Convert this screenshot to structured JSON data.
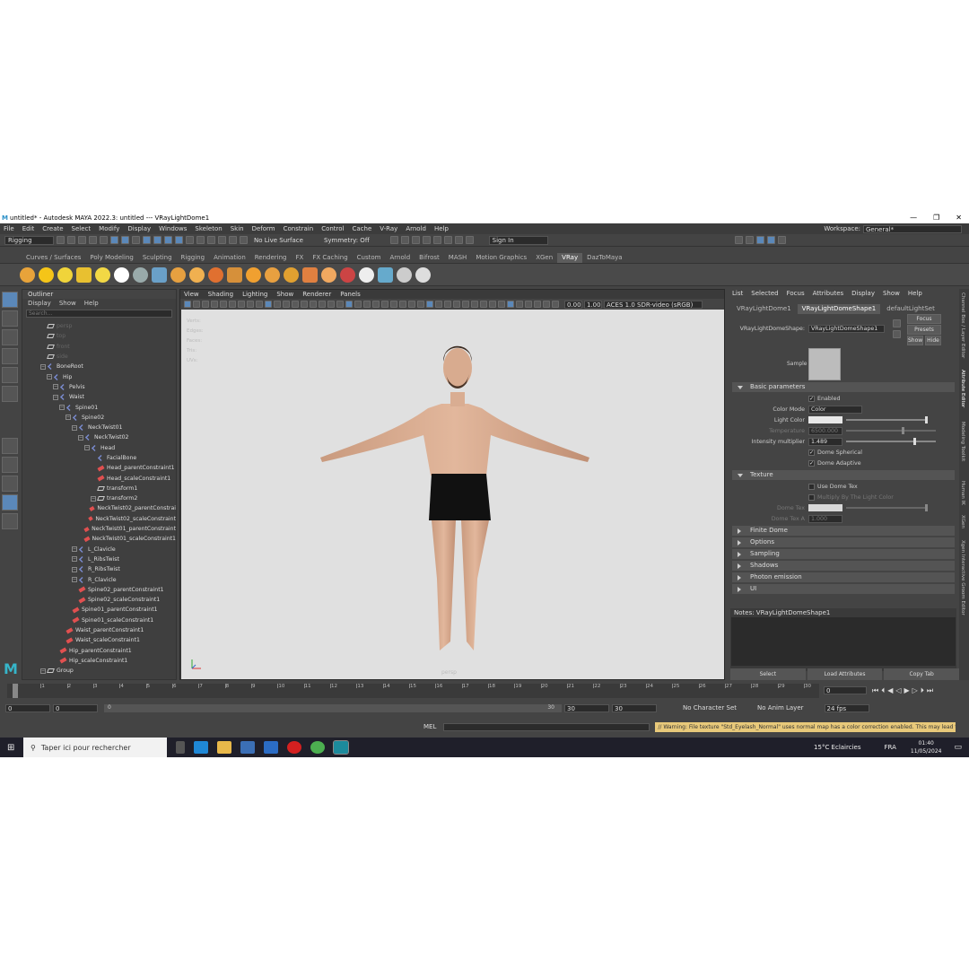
{
  "window": {
    "title": "untitled* - Autodesk MAYA 2022.3: untitled  ---  VRayLightDome1",
    "min": "—",
    "max": "❐",
    "close": "✕"
  },
  "menubar": {
    "items": [
      "File",
      "Edit",
      "Create",
      "Select",
      "Modify",
      "Display",
      "Windows",
      "Skeleton",
      "Skin",
      "Deform",
      "Constrain",
      "Control",
      "Cache",
      "V-Ray",
      "Arnold",
      "Help"
    ],
    "workspace_label": "Workspace:",
    "workspace_value": "General*"
  },
  "statusline": {
    "menuset": "Rigging",
    "live_surface": "No Live Surface",
    "symmetry": "Symmetry: Off",
    "sign_in": "Sign In"
  },
  "shelf": {
    "tabs": [
      "Curves / Surfaces",
      "Poly Modeling",
      "Sculpting",
      "Rigging",
      "Animation",
      "Rendering",
      "FX",
      "FX Caching",
      "Custom",
      "Arnold",
      "Bifrost",
      "MASH",
      "Motion Graphics",
      "XGen",
      "VRay",
      "DazToMaya"
    ],
    "active": "VRay",
    "icon_colors": [
      "#e8a33a",
      "#f5c518",
      "#f0d43a",
      "#e8c030",
      "#f2d845",
      "#ffffff",
      "#9aa",
      "#6aa0c8",
      "#e6a040",
      "#f0b050",
      "#e07030",
      "#d6903a",
      "#f0a030",
      "#e8a040",
      "#e0a030",
      "#e08040",
      "#f0a860",
      "#c44",
      "#eee",
      "#6ac",
      "#ccc",
      "#ddd"
    ]
  },
  "outliner": {
    "title": "Outliner",
    "menu": [
      "Display",
      "Show",
      "Help"
    ],
    "search_placeholder": "Search...",
    "nodes": [
      {
        "label": "persp",
        "indent": 0,
        "type": "cam",
        "dim": true
      },
      {
        "label": "top",
        "indent": 0,
        "type": "cam",
        "dim": true
      },
      {
        "label": "front",
        "indent": 0,
        "type": "cam",
        "dim": true
      },
      {
        "label": "side",
        "indent": 0,
        "type": "cam",
        "dim": true
      },
      {
        "label": "BoneRoot",
        "indent": 0,
        "type": "joint",
        "exp": true
      },
      {
        "label": "Hip",
        "indent": 1,
        "type": "joint",
        "exp": true
      },
      {
        "label": "Pelvis",
        "indent": 2,
        "type": "joint",
        "exp": true
      },
      {
        "label": "Waist",
        "indent": 2,
        "type": "joint",
        "exp": true
      },
      {
        "label": "Spine01",
        "indent": 3,
        "type": "joint",
        "exp": true
      },
      {
        "label": "Spine02",
        "indent": 4,
        "type": "joint",
        "exp": true
      },
      {
        "label": "NeckTwist01",
        "indent": 5,
        "type": "joint",
        "exp": true
      },
      {
        "label": "NeckTwist02",
        "indent": 6,
        "type": "joint",
        "exp": true
      },
      {
        "label": "Head",
        "indent": 7,
        "type": "joint",
        "exp": true
      },
      {
        "label": "FacialBone",
        "indent": 8,
        "type": "joint"
      },
      {
        "label": "Head_parentConstraint1",
        "indent": 8,
        "type": "con"
      },
      {
        "label": "Head_scaleConstraint1",
        "indent": 8,
        "type": "con"
      },
      {
        "label": "transform1",
        "indent": 8,
        "type": "tf"
      },
      {
        "label": "transform2",
        "indent": 8,
        "type": "tf",
        "exp": true
      },
      {
        "label": "NeckTwist02_parentConstrai",
        "indent": 7,
        "type": "con"
      },
      {
        "label": "NeckTwist02_scaleConstraint",
        "indent": 7,
        "type": "con"
      },
      {
        "label": "NeckTwist01_parentConstraint",
        "indent": 6,
        "type": "con"
      },
      {
        "label": "NeckTwist01_scaleConstraint1",
        "indent": 6,
        "type": "con"
      },
      {
        "label": "L_Clavicle",
        "indent": 5,
        "type": "joint",
        "exp": true
      },
      {
        "label": "L_RibsTwist",
        "indent": 5,
        "type": "joint",
        "exp": true
      },
      {
        "label": "R_RibsTwist",
        "indent": 5,
        "type": "joint",
        "exp": true
      },
      {
        "label": "R_Clavicle",
        "indent": 5,
        "type": "joint",
        "exp": true
      },
      {
        "label": "Spine02_parentConstraint1",
        "indent": 5,
        "type": "con"
      },
      {
        "label": "Spine02_scaleConstraint1",
        "indent": 5,
        "type": "con"
      },
      {
        "label": "Spine01_parentConstraint1",
        "indent": 4,
        "type": "con"
      },
      {
        "label": "Spine01_scaleConstraint1",
        "indent": 4,
        "type": "con"
      },
      {
        "label": "Waist_parentConstraint1",
        "indent": 3,
        "type": "con"
      },
      {
        "label": "Waist_scaleConstraint1",
        "indent": 3,
        "type": "con"
      },
      {
        "label": "Hip_parentConstraint1",
        "indent": 2,
        "type": "con"
      },
      {
        "label": "Hip_scaleConstraint1",
        "indent": 2,
        "type": "con"
      },
      {
        "label": "Group",
        "indent": 0,
        "type": "group",
        "exp": true
      }
    ]
  },
  "viewport": {
    "menu": [
      "View",
      "Shading",
      "Lighting",
      "Show",
      "Renderer",
      "Panels"
    ],
    "exposure": "0.00",
    "gamma": "1.00",
    "colorspace": "ACES 1.0 SDR-video (sRGB)",
    "camera_label": "persp",
    "hud": [
      "Verts:",
      "Edges:",
      "Faces:",
      "Tris:",
      "UVs:"
    ]
  },
  "attribute_editor": {
    "menu": [
      "List",
      "Selected",
      "Focus",
      "Attributes",
      "Display",
      "Show",
      "Help"
    ],
    "tabs": [
      "VRayLightDome1",
      "VRayLightDomeShape1",
      "defaultLightSet"
    ],
    "active_tab": "VRayLightDomeShape1",
    "shape_label": "VRayLightDomeShape:",
    "shape_value": "VRayLightDomeShape1",
    "focus": "Focus",
    "presets": "Presets",
    "show": "Show",
    "hide": "Hide",
    "sample_label": "Sample",
    "basic": {
      "title": "Basic parameters",
      "enabled": "Enabled",
      "color_mode_label": "Color Mode",
      "color_mode": "Color",
      "light_color_label": "Light Color",
      "temperature_label": "Temperature",
      "temperature": "6500.000",
      "intensity_label": "Intensity multiplier",
      "intensity": "1.489",
      "dome_spherical": "Dome Spherical",
      "dome_adaptive": "Dome Adaptive"
    },
    "texture": {
      "title": "Texture",
      "use_dome_tex": "Use Dome Tex",
      "multiply": "Multiply By The Light Color",
      "dome_tex_label": "Dome Tex",
      "dome_tex_a_label": "Dome Tex A",
      "dome_tex_a": "1.000"
    },
    "collapsed": [
      "Finite Dome",
      "Options",
      "Sampling",
      "Shadows",
      "Photon emission",
      "UI"
    ],
    "notes": "Notes:  VRayLightDomeShape1",
    "buttons": [
      "Select",
      "Load Attributes",
      "Copy Tab"
    ]
  },
  "side_tabs": [
    "Channel Box / Layer Editor",
    "Attribute Editor",
    "Modeling Toolkit",
    "Human IK",
    "XGen",
    "Xgen Interactive Groom Editor"
  ],
  "time": {
    "ticks": [
      "0",
      "1",
      "2",
      "3",
      "4",
      "5",
      "6",
      "7",
      "8",
      "9",
      "10",
      "11",
      "12",
      "13",
      "14",
      "15",
      "16",
      "17",
      "18",
      "19",
      "20",
      "21",
      "22",
      "23",
      "24",
      "25",
      "26",
      "27",
      "28",
      "29",
      "30"
    ],
    "labels": [
      "0",
      "5",
      "10",
      "15",
      "20",
      "25",
      "30"
    ],
    "current": "0"
  },
  "range": {
    "start": "0",
    "anim_start": "0",
    "slider_start": "0",
    "slider_end": "30",
    "end": "30",
    "anim_end": "30",
    "character_set": "No Character Set",
    "anim_layer": "No Anim Layer",
    "fps": "24 fps"
  },
  "cmdline": {
    "lang": "MEL",
    "warning": "// Warning: File texture \"Std_Eyelash_Normal\" uses normal map has a color correction enabled. This may lead to"
  },
  "taskbar": {
    "search": "Taper ici pour rechercher",
    "weather": "15°C  Eclaircies",
    "lang": "FRA",
    "time": "01:40",
    "date": "11/05/2024"
  }
}
